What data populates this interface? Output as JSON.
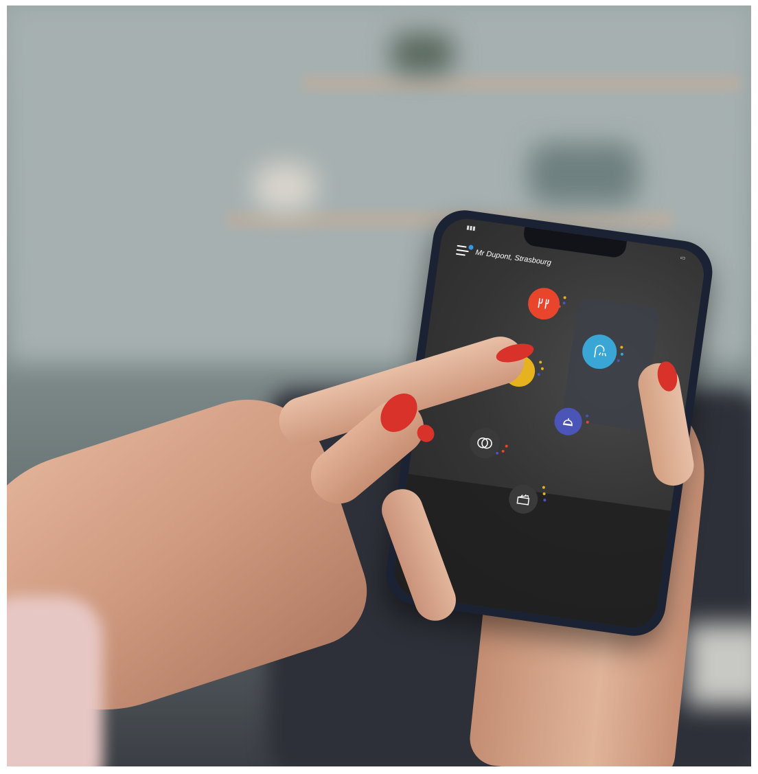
{
  "phone_screen": {
    "header": {
      "user_label": "Mr Dupont, Strasbourg",
      "menu_icon": "hamburger-menu-icon"
    },
    "services": [
      {
        "name": "restaurant",
        "icon": "cutlery-icon",
        "color": "#e8452c"
      },
      {
        "name": "spa",
        "icon": "shower-icon",
        "color": "#3aa6d6"
      },
      {
        "name": "room-service",
        "icon": "lamp-icon",
        "color": "#e6b21f"
      },
      {
        "name": "concierge",
        "icon": "bell-icon",
        "color": "#4b55b8"
      },
      {
        "name": "events",
        "icon": "rings-icon",
        "color": "#3a3a3a"
      },
      {
        "name": "entertainment",
        "icon": "clapperboard-icon",
        "color": "#3a3a3a"
      }
    ]
  },
  "colors": {
    "nail_polish": "#d8322a",
    "phone_frame": "#1b2233"
  }
}
